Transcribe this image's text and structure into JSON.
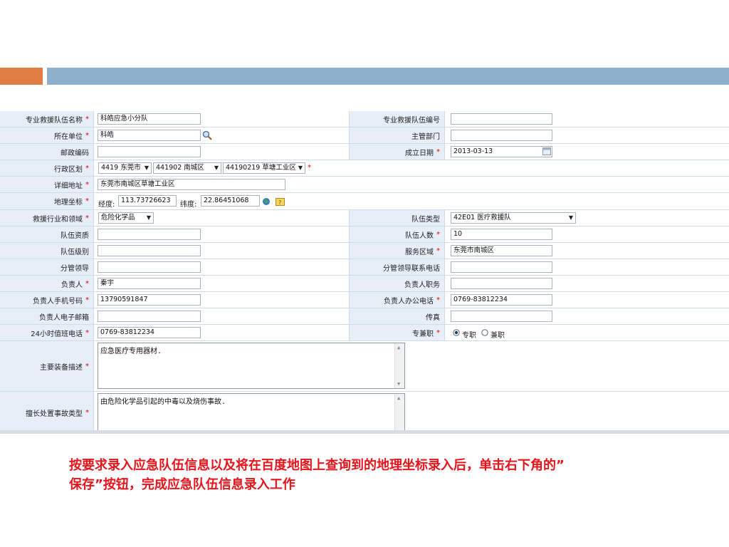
{
  "form": {
    "team_name_label": "专业救援队伍名称",
    "team_name_value": "科皓应急小分队",
    "team_code_label": "专业救援队伍编号",
    "unit_label": "所在单位",
    "unit_value": "科皓",
    "dept_label": "主管部门",
    "postcode_label": "邮政编码",
    "founded_label": "成立日期",
    "founded_value": "2013-03-13",
    "region_label": "行政区划",
    "region_city": "4419 东莞市",
    "region_district": "441902 南城区",
    "region_area": "44190219 草塘工业区",
    "address_label": "详细地址",
    "address_value": "东莞市南城区草塘工业区",
    "geo_label": "地理坐标",
    "lng_label": "经度:",
    "lng_value": "113.73726623",
    "lat_label": "纬度:",
    "lat_value": "22.86451068",
    "industry_label": "救援行业和领域",
    "industry_value": "危险化学品",
    "team_type_label": "队伍类型",
    "team_type_value": "42E01 医疗救援队",
    "qualification_label": "队伍资质",
    "headcount_label": "队伍人数",
    "headcount_value": "10",
    "level_label": "队伍级别",
    "service_area_label": "服务区域",
    "service_area_value": "东莞市南城区",
    "leader_label": "分管领导",
    "leader_phone_label": "分管领导联系电话",
    "manager_label": "负责人",
    "manager_value": "秦宇",
    "manager_title_label": "负责人职务",
    "manager_mobile_label": "负责人手机号码",
    "manager_mobile_value": "13790591847",
    "manager_office_label": "负责人办公电话",
    "manager_office_value": "0769-83812234",
    "manager_email_label": "负责人电子邮箱",
    "fax_label": "传真",
    "duty_phone_label": "24小时值班电话",
    "duty_phone_value": "0769-83812234",
    "fulltime_label": "专兼职",
    "fulltime_option": "专职",
    "parttime_option": "兼职",
    "equipment_label": "主要装备描述",
    "equipment_value": "应急医疗专用器材.",
    "specialty_label": "擅长处置事故类型",
    "specialty_value": "由危险化学品引起的中毒以及烧伤事故."
  },
  "caption": {
    "line1": "按要求录入应急队伍信息以及将在百度地图上查询到的地理坐标录入后，单击右下角的”",
    "line2": "保存”按钮，完成应急队伍信息录入工作"
  },
  "colors": {
    "accent_orange": "#e07d45",
    "accent_blue": "#8fb0cc",
    "label_bg": "#e6eff8",
    "caption_red": "#e8141b"
  }
}
